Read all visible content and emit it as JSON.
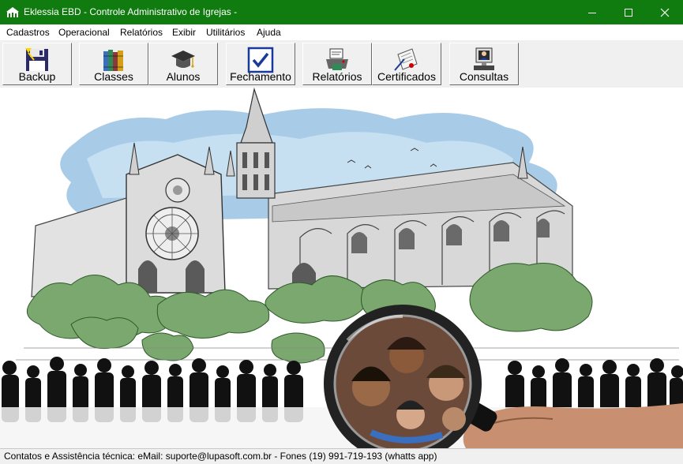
{
  "window": {
    "title": "Eklessia EBD - Controle Administrativo de Igrejas -",
    "app_icon": "church-icon",
    "controls": [
      "minimize-icon",
      "maximize-icon",
      "close-icon"
    ]
  },
  "menu": {
    "items": [
      {
        "label": "Cadastros"
      },
      {
        "label": "Operacional"
      },
      {
        "label": "Relatórios"
      },
      {
        "label": "Exibir"
      },
      {
        "label": "Utilitários"
      },
      {
        "label": "Ajuda"
      }
    ]
  },
  "toolbar": {
    "buttons": [
      {
        "label": "Backup",
        "icon": "floppy-disk-icon"
      },
      {
        "label": "Classes",
        "icon": "books-icon"
      },
      {
        "label": "Alunos",
        "icon": "graduation-cap-icon"
      },
      {
        "label": "Fechamento",
        "icon": "checkbox-icon"
      },
      {
        "label": "Relatórios",
        "icon": "report-printer-icon"
      },
      {
        "label": "Certificados",
        "icon": "certificate-icon"
      },
      {
        "label": "Consultas",
        "icon": "computer-user-icon"
      }
    ]
  },
  "canvas": {
    "image": "cathedral-illustration-with-magnifier-and-people",
    "colors": {
      "sky": "#a8cce8",
      "trees": "#7ba86e",
      "stone": "#d8d8d8"
    }
  },
  "status": {
    "text": "Contatos e Assistência técnica: eMail: suporte@lupasoft.com.br - Fones (19) 991-719-193 (whatts app)"
  },
  "colors": {
    "titlebar": "#107c10",
    "toolbar_bg": "#f0f0f0"
  }
}
